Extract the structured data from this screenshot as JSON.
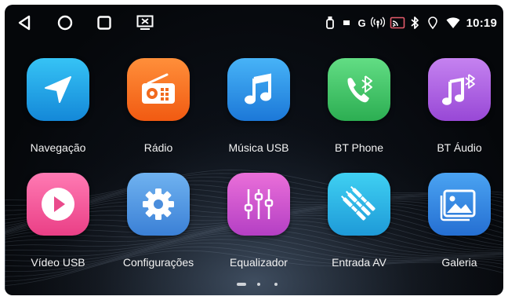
{
  "status": {
    "clock": "10:19",
    "icons": [
      "usb-icon",
      "sd-card-icon",
      "g-network-icon",
      "hotspot-icon",
      "cast-icon",
      "bluetooth-icon",
      "location-icon",
      "wifi-icon"
    ],
    "network_letter": "G"
  },
  "navbar": {
    "buttons": [
      "back-icon",
      "home-icon",
      "recents-icon",
      "screen-mirror-icon"
    ]
  },
  "apps": [
    {
      "label": "Navegação",
      "icon": "navigation-arrow-icon",
      "color_top": "#36c3f5",
      "color_bottom": "#1488d8"
    },
    {
      "label": "Rádio",
      "icon": "radio-icon",
      "color_top": "#ff8f3a",
      "color_bottom": "#f15a12"
    },
    {
      "label": "Música USB",
      "icon": "music-note-icon",
      "color_top": "#47b3f7",
      "color_bottom": "#1c78d8"
    },
    {
      "label": "BT Phone",
      "icon": "bluetooth-phone-icon",
      "color_top": "#62dd84",
      "color_bottom": "#2cae52"
    },
    {
      "label": "BT Áudio",
      "icon": "bluetooth-music-icon",
      "color_top": "#c582f0",
      "color_bottom": "#9848d6"
    },
    {
      "label": "Vídeo USB",
      "icon": "play-icon",
      "color_top": "#ff7ab3",
      "color_bottom": "#ea3f86"
    },
    {
      "label": "Configurações",
      "icon": "gear-icon",
      "color_top": "#6fb2f0",
      "color_bottom": "#3b80d6"
    },
    {
      "label": "Equalizador",
      "icon": "equalizer-icon",
      "color_top": "#ea6fd9",
      "color_bottom": "#b43fc4"
    },
    {
      "label": "Entrada AV",
      "icon": "av-cable-icon",
      "color_top": "#3fd0f2",
      "color_bottom": "#1e9ad8"
    },
    {
      "label": "Galeria",
      "icon": "gallery-icon",
      "color_top": "#4aa3f2",
      "color_bottom": "#256fd2"
    }
  ],
  "pager": {
    "pages": 3,
    "current": 1
  },
  "colors": {
    "background": "#080b10",
    "label": "#f2f2f2",
    "status_icons": "#ffffff"
  }
}
